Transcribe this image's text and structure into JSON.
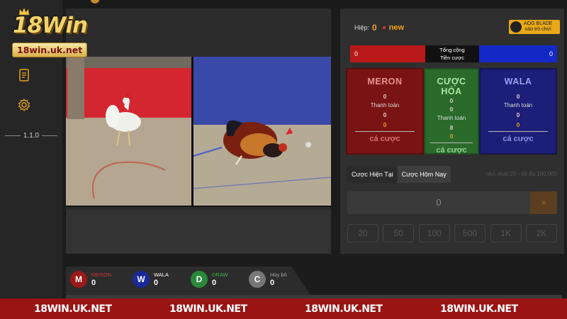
{
  "sidebar": {
    "logo_text": "18Win",
    "logo_url": "18win.uk.net",
    "version": "1.1.0",
    "icons": [
      "document-icon",
      "gear-icon"
    ]
  },
  "round": {
    "label": "Hiệp:",
    "number": "0",
    "status": "new"
  },
  "provider": {
    "name": "AOG BLADE",
    "action": "vào trò chơi"
  },
  "totals": {
    "meron_total": "0",
    "label_line1": "Tổng cộng",
    "label_line2": "Tiền cược",
    "wala_total": "0"
  },
  "boxes": {
    "meron": {
      "title": "MERON",
      "top": "0",
      "mid": "0",
      "label": "Thanh toán",
      "payout": "0",
      "gold": "0",
      "button": "cá cược"
    },
    "draw": {
      "title": "CƯỢC HÒA",
      "top": "0",
      "mid": "0",
      "label": "Thanh toán",
      "payout": "8",
      "gold": "0",
      "button": "cá cược"
    },
    "wala": {
      "title": "WALA",
      "top": "0",
      "mid": "0",
      "label": "Thanh toán",
      "payout": "0",
      "gold": "0",
      "button": "cá cược"
    }
  },
  "tabs": {
    "current": "Cược Hiện Tại",
    "today": "Cược Hôm Nay"
  },
  "limits": "nhỏ nhất:20 - tối đa:100,000",
  "amount": {
    "value": "0",
    "clear": "×"
  },
  "chips": [
    "20",
    "50",
    "100",
    "500",
    "1K",
    "2K"
  ],
  "stats": {
    "meron": {
      "letter": "M",
      "label": "MERON",
      "value": "0"
    },
    "wala": {
      "letter": "W",
      "label": "WALA",
      "value": "0"
    },
    "draw": {
      "letter": "D",
      "label": "DRAW",
      "value": "0"
    },
    "cancel": {
      "letter": "C",
      "label": "Hủy bỏ",
      "value": "0"
    }
  },
  "banner": [
    "18WIN.UK.NET",
    "18WIN.UK.NET",
    "18WIN.UK.NET",
    "18WIN.UK.NET"
  ],
  "colors": {
    "meron": "#b81818",
    "wala": "#1428c8",
    "draw": "#2a8a3a",
    "accent": "#f0a020",
    "banner": "#9a1414"
  }
}
